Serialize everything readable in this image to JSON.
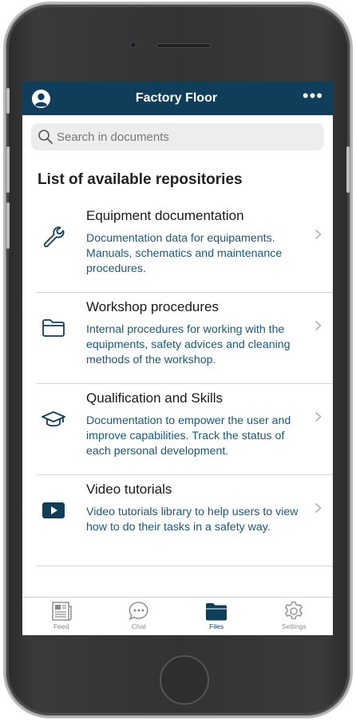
{
  "header": {
    "title": "Factory Floor",
    "menu_glyph": "•••"
  },
  "search": {
    "placeholder": "Search in documents",
    "value": ""
  },
  "section_title": "List of available repositories",
  "repositories": [
    {
      "name": "Equipment documentation",
      "description": "Documentation data for equipaments. Manuals, schematics and maintenance procedures.",
      "icon": "wrench-icon"
    },
    {
      "name": "Workshop procedures",
      "description": "Internal procedures for working with the equipments, safety advices and cleaning methods of the workshop.",
      "icon": "folder-icon"
    },
    {
      "name": "Qualification and Skills",
      "description": "Documentation to empower the user and improve capabilities. Track the status of each personal development.",
      "icon": "graduation-cap-icon"
    },
    {
      "name": "Video tutorials",
      "description": "Video tutorials library to help users to view how to do their tasks in a safety way.",
      "icon": "play-video-icon"
    }
  ],
  "tabs": [
    {
      "label": "Feed",
      "icon": "newspaper-icon",
      "active": false
    },
    {
      "label": "Chat",
      "icon": "chat-bubble-icon",
      "active": false
    },
    {
      "label": "Files",
      "icon": "folder-icon",
      "active": true
    },
    {
      "label": "Settings",
      "icon": "gear-icon",
      "active": false
    }
  ],
  "colors": {
    "header_bg": "#0e3e5a",
    "accent": "#0e3e5a",
    "description_text": "#175a7d",
    "inactive_tab": "#8a8a8a"
  }
}
